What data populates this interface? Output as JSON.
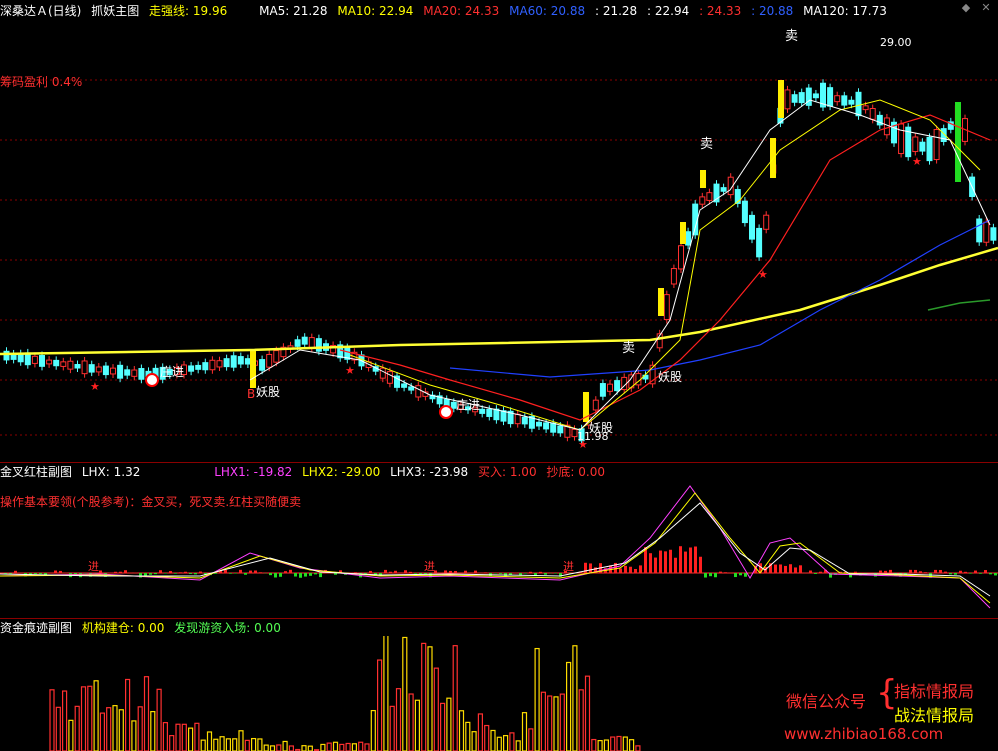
{
  "header": {
    "stock": "深桑达Ａ(日线)",
    "indicator": "抓妖主图",
    "trend_label": "走强线: 19.96",
    "ma": [
      {
        "label": "MA5: 21.28",
        "color": "#ffffff"
      },
      {
        "label": "MA10: 22.94",
        "color": "#ffff00"
      },
      {
        "label": "MA20: 24.33",
        "color": "#ff3030"
      },
      {
        "label": "MA60: 20.88",
        "color": "#3060ff"
      },
      {
        "label": ": 21.28",
        "color": "#ffffff"
      },
      {
        "label": ": 22.94",
        "color": "#ffffff"
      },
      {
        "label": ": 24.33",
        "color": "#ff3030"
      },
      {
        "label": ": 20.88",
        "color": "#3060ff"
      },
      {
        "label": "MA120: 17.73",
        "color": "#ffffff"
      }
    ]
  },
  "main": {
    "chip_profit": "筹码盈利 0.4%",
    "high_label": "29.00",
    "low_label": "11.98",
    "sell_labels": [
      "卖",
      "卖",
      "卖"
    ],
    "yao_labels": [
      "妖股",
      "妖股",
      "妖股"
    ],
    "zhuang_labels": [
      "庄进",
      "庄进"
    ],
    "b_label": "B"
  },
  "sub1": {
    "title": "金叉红柱副图",
    "lhx": "LHX: 1.32",
    "lhx1": "LHX1: -19.82",
    "lhx2": "LHX2: -29.00",
    "lhx3": "LHX3: -23.98",
    "buy": "买入: 1.00",
    "bottom": "抄底: 0.00",
    "note": "操作基本要领(个股参考)：金叉买，死叉卖.红柱买随便卖",
    "jin_label": "进"
  },
  "sub2": {
    "title": "资金痕迹副图",
    "inst": "机构建仓: 0.00",
    "hot": "发现游资入场: 0.00"
  },
  "watermark": {
    "wechat": "微信公众号",
    "name1": "指标情报局",
    "name2": "战法情报局",
    "url": "www.zhibiao168.com"
  },
  "colors": {
    "up": "#ff3030",
    "down": "#54ffff",
    "panel_border": "#8a0000"
  }
}
